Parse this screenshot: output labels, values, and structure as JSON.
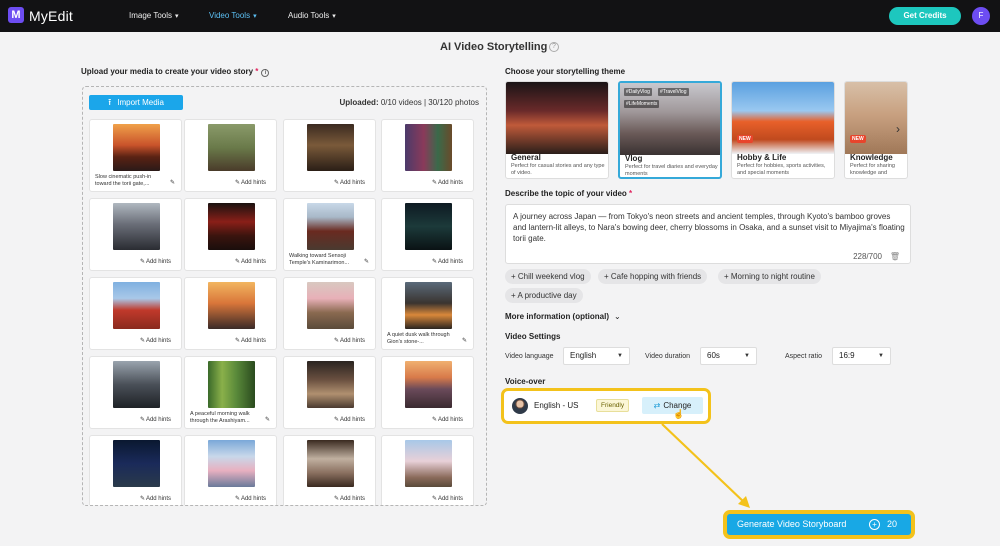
{
  "app": {
    "brand": "MyEdit",
    "logo_letter": "M"
  },
  "nav": [
    {
      "label": "Image Tools",
      "active": false
    },
    {
      "label": "Video Tools",
      "active": true
    },
    {
      "label": "Audio Tools",
      "active": false
    }
  ],
  "header": {
    "credits_label": "Get Credits",
    "avatar_initial": "F"
  },
  "page": {
    "title": "AI Video Storytelling"
  },
  "upload": {
    "label": "Upload your media to create your video story",
    "required_mark": "*",
    "import_label": "Import Media",
    "uploaded_prefix": "Uploaded:",
    "uploaded_stats": "0/10 videos | 30/120 photos",
    "add_hints_label": "Add hints",
    "items": [
      {
        "caption": "Slow cinematic push-in toward the torii gate,..."
      },
      {
        "caption": ""
      },
      {
        "caption": ""
      },
      {
        "caption": ""
      },
      {
        "caption": ""
      },
      {
        "caption": ""
      },
      {
        "caption": "Walking toward Sensoji Temple's Kaminarimon..."
      },
      {
        "caption": ""
      },
      {
        "caption": ""
      },
      {
        "caption": ""
      },
      {
        "caption": ""
      },
      {
        "caption": "A quiet dusk walk through Gion's stone-..."
      },
      {
        "caption": ""
      },
      {
        "caption": "A peaceful morning walk through the Arashiyam..."
      },
      {
        "caption": ""
      },
      {
        "caption": ""
      },
      {
        "caption": ""
      },
      {
        "caption": ""
      },
      {
        "caption": ""
      },
      {
        "caption": ""
      }
    ]
  },
  "theme": {
    "label": "Choose your storytelling theme",
    "items": [
      {
        "name": "General",
        "desc": "Perfect for casual stories and any type of video.",
        "tags": [],
        "is_new": false
      },
      {
        "name": "Vlog",
        "desc": "Perfect for travel diaries and everyday moments",
        "tags": [
          "#DailyVlog",
          "#TravelVlog",
          "#LifeMoments"
        ],
        "is_new": false
      },
      {
        "name": "Hobby & Life",
        "desc": "Perfect for hobbies, sports activities, and special moments",
        "tags": [],
        "is_new": true
      },
      {
        "name": "Knowledge",
        "desc": "Perfect for sharing knowledge and professional insights",
        "tags": [],
        "is_new": true
      }
    ],
    "new_badge": "NEW"
  },
  "topic": {
    "label": "Describe the topic of your video",
    "required_mark": "*",
    "text": "A journey across Japan — from Tokyo's neon streets and ancient temples, through Kyoto's bamboo groves and lantern-lit alleys, to Nara's bowing deer, cherry blossoms in Osaka, and a sunset visit to Miyajima's floating torii gate.",
    "counter": "228/700",
    "suggestions": [
      "+ Chill weekend vlog",
      "+ Cafe hopping with friends",
      "+ Morning to night routine",
      "+ A productive day"
    ]
  },
  "more_info": {
    "label": "More information (optional)"
  },
  "video_settings": {
    "label": "Video Settings",
    "language_label": "Video language",
    "language_value": "English",
    "duration_label": "Video duration",
    "duration_value": "60s",
    "aspect_label": "Aspect ratio",
    "aspect_value": "16:9"
  },
  "voiceover": {
    "label": "Voice-over",
    "voice_name": "English - US",
    "style_badge": "Friendly",
    "change_label": "Change"
  },
  "generate": {
    "label": "Generate Video Storyboard",
    "credit_cost": "20"
  },
  "colors": {
    "accent": "#18a8e5",
    "highlight": "#f3c21b",
    "credits": "#1dc7be",
    "brand": "#6d4df2"
  }
}
